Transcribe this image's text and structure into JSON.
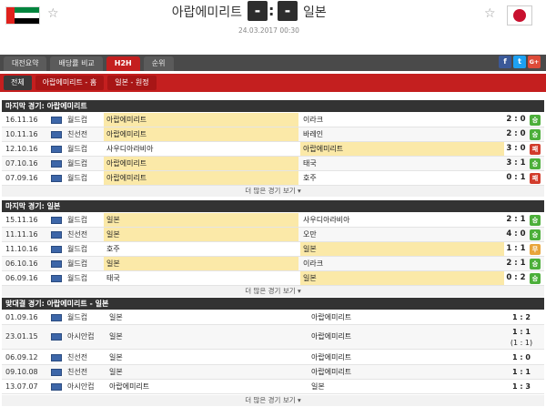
{
  "header": {
    "home_team": "아랍에미리트",
    "away_team": "일본",
    "home_score": "-",
    "away_score": "-",
    "separator": ":",
    "datetime": "24.03.2017 00:30",
    "star_icon": "☆",
    "uae_flag_colors": [
      "#e0211c",
      "#00843d",
      "#ffffff",
      "#000000"
    ],
    "japan_flag_colors": [
      "#ffffff",
      "#c8102e"
    ]
  },
  "tabs": [
    {
      "label": "대전요약"
    },
    {
      "label": "배당률 비교"
    },
    {
      "label": "H2H"
    },
    {
      "label": "순위"
    }
  ],
  "social": {
    "facebook": "f",
    "twitter": "t",
    "google": "G+"
  },
  "subtabs": [
    {
      "label": "전체"
    },
    {
      "label": "아랍에미리트 - 홈"
    },
    {
      "label": "일본 - 원정"
    }
  ],
  "sections": [
    {
      "title": "마지막 경기: 아랍에미리트",
      "more": "더 많은 경기 보기 ▾",
      "rows": [
        {
          "date": "16.11.16",
          "comp": "월드컵",
          "home": "아랍에미리트",
          "away": "이라크",
          "score": "2 : 0",
          "result": "승",
          "hl": "home"
        },
        {
          "date": "10.11.16",
          "comp": "친선전",
          "home": "아랍에미리트",
          "away": "바레인",
          "score": "2 : 0",
          "result": "승",
          "hl": "home"
        },
        {
          "date": "12.10.16",
          "comp": "월드컵",
          "home": "사우디아라비아",
          "away": "아랍에미리트",
          "score": "3 : 0",
          "result": "패",
          "hl": "away"
        },
        {
          "date": "07.10.16",
          "comp": "월드컵",
          "home": "아랍에미리트",
          "away": "태국",
          "score": "3 : 1",
          "result": "승",
          "hl": "home"
        },
        {
          "date": "07.09.16",
          "comp": "월드컵",
          "home": "아랍에미리트",
          "away": "호주",
          "score": "0 : 1",
          "result": "패",
          "hl": "home"
        }
      ]
    },
    {
      "title": "마지막 경기: 일본",
      "more": "더 많은 경기 보기 ▾",
      "rows": [
        {
          "date": "15.11.16",
          "comp": "월드컵",
          "home": "일본",
          "away": "사우디아라비아",
          "score": "2 : 1",
          "result": "승",
          "hl": "home"
        },
        {
          "date": "11.11.16",
          "comp": "친선전",
          "home": "일본",
          "away": "오만",
          "score": "4 : 0",
          "result": "승",
          "hl": "home"
        },
        {
          "date": "11.10.16",
          "comp": "월드컵",
          "home": "호주",
          "away": "일본",
          "score": "1 : 1",
          "result": "무",
          "hl": "away"
        },
        {
          "date": "06.10.16",
          "comp": "월드컵",
          "home": "일본",
          "away": "이라크",
          "score": "2 : 1",
          "result": "승",
          "hl": "home"
        },
        {
          "date": "06.09.16",
          "comp": "월드컵",
          "home": "태국",
          "away": "일본",
          "score": "0 : 2",
          "result": "승",
          "hl": "away"
        }
      ]
    },
    {
      "title": "맞대결 경기: 아랍에미리트 - 일본",
      "more": "더 많은 경기 보기 ▾",
      "rows": [
        {
          "date": "01.09.16",
          "comp": "월드컵",
          "home": "일본",
          "away": "아랍에미리트",
          "score": "1 : 2",
          "extra": ""
        },
        {
          "date": "23.01.15",
          "comp": "아시안컵",
          "home": "일본",
          "away": "아랍에미리트",
          "score": "1 : 1",
          "extra": "(1 : 1)"
        },
        {
          "date": "06.09.12",
          "comp": "친선전",
          "home": "일본",
          "away": "아랍에미리트",
          "score": "1 : 0",
          "extra": ""
        },
        {
          "date": "09.10.08",
          "comp": "친선전",
          "home": "일본",
          "away": "아랍에미리트",
          "score": "1 : 1",
          "extra": ""
        },
        {
          "date": "13.07.07",
          "comp": "아시안컵",
          "home": "아랍에미리트",
          "away": "일본",
          "score": "1 : 3",
          "extra": ""
        }
      ]
    }
  ]
}
